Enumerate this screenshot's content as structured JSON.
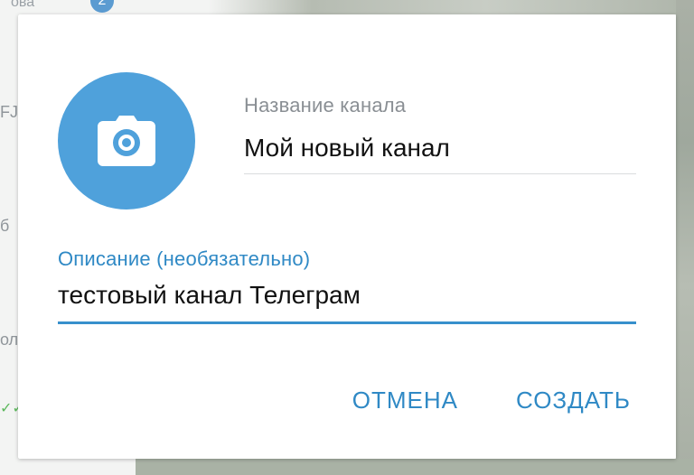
{
  "background": {
    "top_text": "ова",
    "badge_count": "2",
    "side_glyphs": [
      "FJ",
      "б",
      "ол"
    ],
    "check_mark": "✓✓"
  },
  "dialog": {
    "avatar": {
      "icon": "camera-icon",
      "color": "#4fa1db"
    },
    "channel_name": {
      "label": "Название канала",
      "value": "Мой новый канал"
    },
    "description": {
      "label": "Описание (необязательно)",
      "value": "тестовый канал Телеграм"
    },
    "buttons": {
      "cancel": "ОТМЕНА",
      "create": "СОЗДАТЬ"
    },
    "accent_color": "#2f89c5"
  }
}
